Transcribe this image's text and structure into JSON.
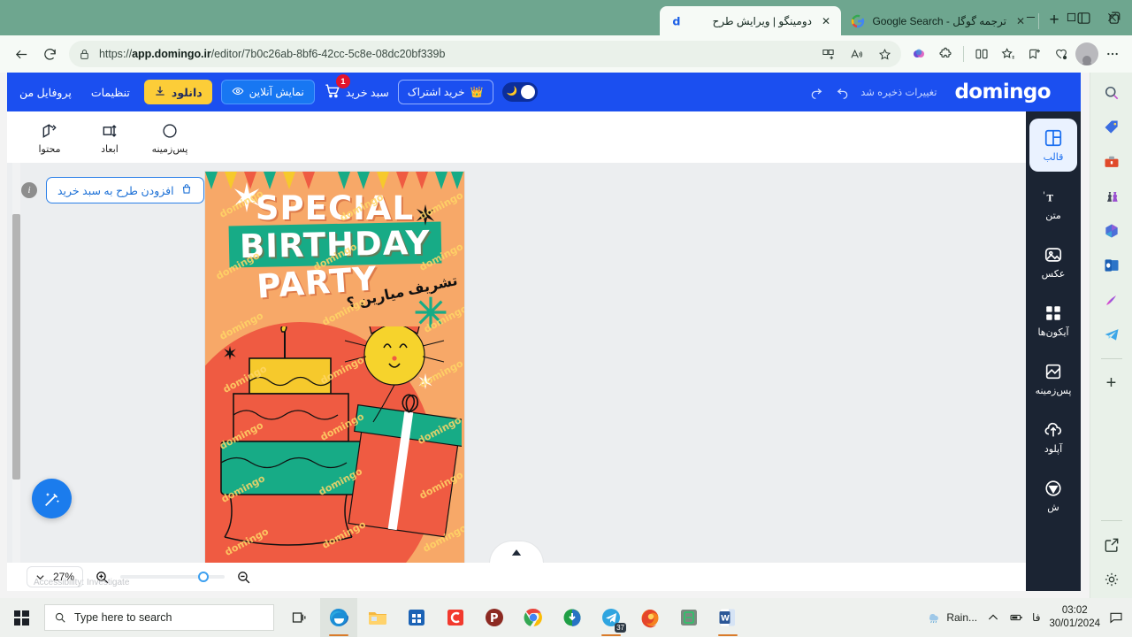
{
  "browser": {
    "tabs": [
      {
        "title": "دومینگو | ویرایش طرح",
        "favicon": "domingo-icon",
        "active": true,
        "close_label": "✕"
      },
      {
        "title": "ترجمه گوگل - Google Search",
        "favicon": "google-icon",
        "active": false,
        "close_label": "✕"
      }
    ],
    "newtab_label": "+",
    "url_prefix": "https://",
    "url_domain": "app.domingo.ir",
    "url_path": "/editor/7b0c26ab-8bf6-42cc-5c8e-08dc20bf339b",
    "window_controls": {
      "minimize": "minimize-icon",
      "maximize": "maximize-icon",
      "close": "close-icon"
    }
  },
  "edge_sidebar": {
    "items": [
      {
        "name": "search-icon"
      },
      {
        "name": "shopping-tag-icon"
      },
      {
        "name": "tools-icon"
      },
      {
        "name": "games-icon"
      },
      {
        "name": "microsoft-365-icon"
      },
      {
        "name": "outlook-icon"
      },
      {
        "name": "designer-icon"
      },
      {
        "name": "telegram-icon"
      }
    ],
    "add_label": "+",
    "bottom": [
      {
        "name": "open-external-icon"
      },
      {
        "name": "settings-gear-icon"
      },
      {
        "name": "copilot-icon"
      }
    ]
  },
  "app_header": {
    "logo": "domingo",
    "saved_text": "تغییرات ذخیره شد",
    "undo_icon": "undo-icon",
    "redo_icon": "redo-icon",
    "theme_toggle": {
      "name": "dark-mode-toggle",
      "state": "off"
    },
    "subscription_button": "خرید اشتراک",
    "subscription_icon": "crown-icon",
    "cart_label": "سبد خرید",
    "cart_count": "1",
    "preview_button": "نمایش آنلاین",
    "download_button": "دانلود",
    "settings_link": "تنظیمات",
    "profile_link": "پروفایل من"
  },
  "toolbar": {
    "tools": [
      {
        "label": "پس‌زمینه",
        "icon": "circle-background-icon"
      },
      {
        "label": "ابعاد",
        "icon": "resize-dimensions-icon"
      },
      {
        "label": "محتوا",
        "icon": "edit-content-icon"
      }
    ]
  },
  "app_sidebar": {
    "items": [
      {
        "label": "قالب",
        "icon": "template-icon",
        "active": true
      },
      {
        "label": "متن",
        "icon": "text-icon",
        "active": false
      },
      {
        "label": "عکس",
        "icon": "image-icon",
        "active": false
      },
      {
        "label": "آیکون‌ها",
        "icon": "icons-grid-icon",
        "active": false
      },
      {
        "label": "پس‌زمینه",
        "icon": "background-icon",
        "active": false
      },
      {
        "label": "آپلود",
        "icon": "upload-cloud-icon",
        "active": false
      },
      {
        "label": "ش",
        "icon": "shape-icon",
        "active": false
      }
    ]
  },
  "canvas": {
    "cta_button": "افزودن طرح به سبد خرید",
    "cta_icon": "cart-add-icon",
    "info_icon": "info-icon",
    "magic_fab": "magic-wand-icon",
    "collapse_handle": "chevron-up-icon",
    "design": {
      "headline_line1": "SPECIAL",
      "headline_line2": "BIRTHDAY",
      "headline_line3": "PARTY",
      "persian_question": "تشریف میارین ؟",
      "watermark": "domingo",
      "colors": {
        "background": "#f7a868",
        "blob": "#ef5b42",
        "band": "#17ab86",
        "cake_top": "#f6c92c",
        "cake_mid": "#ef5b42",
        "cake_bottom": "#17ab86",
        "balloon": "#f6d32c"
      }
    }
  },
  "zoom_bar": {
    "zoom_value": "27%",
    "chevron_icon": "chevron-down-icon",
    "zoom_in_icon": "zoom-in-icon",
    "zoom_out_icon": "zoom-out-icon",
    "ghost_text": "Accessibility: Investigate"
  },
  "taskbar": {
    "start_icon": "windows-start-icon",
    "search_placeholder": "Type here to search",
    "search_icon": "search-icon",
    "task_view_icon": "task-view-icon",
    "apps": [
      {
        "name": "microsoft-edge-icon",
        "running": true,
        "active": true
      },
      {
        "name": "file-explorer-icon",
        "running": false,
        "active": false
      },
      {
        "name": "microsoft-store-icon",
        "running": false,
        "active": false
      },
      {
        "name": "camtasia-icon",
        "running": false,
        "active": false
      },
      {
        "name": "photoscape-icon",
        "running": false,
        "active": false
      },
      {
        "name": "google-chrome-icon",
        "running": false,
        "active": false
      },
      {
        "name": "internet-download-manager-icon",
        "running": false,
        "active": false
      },
      {
        "name": "telegram-icon",
        "running": true,
        "active": false,
        "badge": "37"
      },
      {
        "name": "firefox-icon",
        "running": false,
        "active": false
      },
      {
        "name": "notepad-icon",
        "running": false,
        "active": false
      },
      {
        "name": "microsoft-word-icon",
        "running": true,
        "active": false
      }
    ],
    "weather": {
      "label": "Rain...",
      "icon": "rain-icon"
    },
    "tray": {
      "chevron_icon": "show-hidden-icons",
      "battery_icon": "battery-icon",
      "language": "فا"
    },
    "time": "03:02",
    "date": "30/01/2024",
    "notification_icon": "notification-icon"
  }
}
